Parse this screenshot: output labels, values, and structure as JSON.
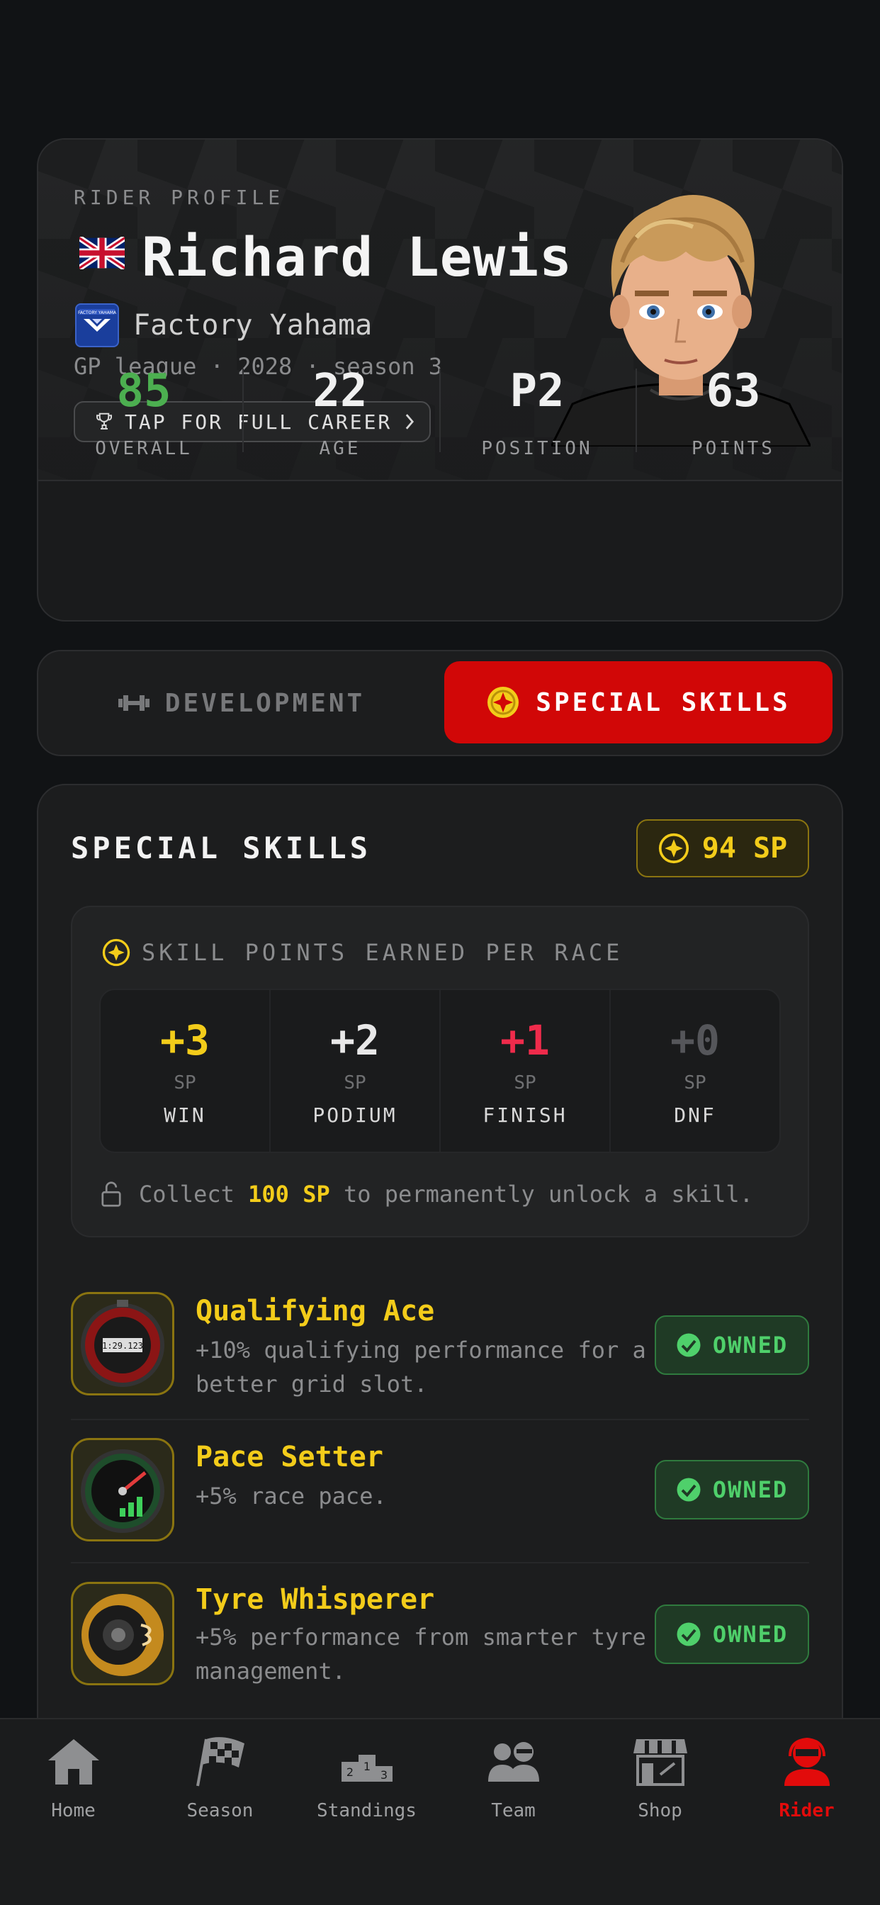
{
  "profile": {
    "section_label": "RIDER PROFILE",
    "name": "Richard Lewis",
    "flag": "uk-flag",
    "team_logo_text": "FACTORY YAHAMA",
    "team": "Factory Yahama",
    "league_line": "GP league · 2028 · season 3",
    "career_button": "TAP FOR FULL CAREER",
    "stats": [
      {
        "value": "85",
        "label": "OVERALL",
        "color": "#4caf50"
      },
      {
        "value": "22",
        "label": "AGE",
        "color": "#f0f0f0"
      },
      {
        "value": "P2",
        "label": "POSITION",
        "color": "#f0f0f0"
      },
      {
        "value": "63",
        "label": "POINTS",
        "color": "#f0f0f0"
      }
    ]
  },
  "tabs": {
    "development": "DEVELOPMENT",
    "special_skills": "SPECIAL SKILLS",
    "active": "special_skills",
    "accent": "#d10707"
  },
  "skills": {
    "title": "SPECIAL SKILLS",
    "sp_balance": "94 SP",
    "earn_title": "SKILL POINTS EARNED PER RACE",
    "earn": [
      {
        "points": "+3",
        "unit": "SP",
        "label": "WIN",
        "color": "#f3cc1a"
      },
      {
        "points": "+2",
        "unit": "SP",
        "label": "PODIUM",
        "color": "#e8e8e8"
      },
      {
        "points": "+1",
        "unit": "SP",
        "label": "FINISH",
        "color": "#ef2b4b"
      },
      {
        "points": "+0",
        "unit": "SP",
        "label": "DNF",
        "color": "#55565a"
      }
    ],
    "collect_prefix": "Collect",
    "collect_amount": "100 SP",
    "collect_suffix": "to permanently unlock a skill.",
    "items": [
      {
        "name": "Qualifying Ace",
        "desc": "+10% qualifying performance for a better grid slot.",
        "status": "OWNED",
        "icon": "stopwatch-icon",
        "icon_text": "1:29.123"
      },
      {
        "name": "Pace Setter",
        "desc": "+5% race pace.",
        "status": "OWNED",
        "icon": "speedometer-icon"
      },
      {
        "name": "Tyre Whisperer",
        "desc": "+5% performance from smarter tyre management.",
        "status": "OWNED",
        "icon": "tyre-icon"
      }
    ]
  },
  "nav": {
    "items": [
      {
        "label": "Home",
        "icon": "home-icon"
      },
      {
        "label": "Season",
        "icon": "checkered-flag-icon"
      },
      {
        "label": "Standings",
        "icon": "podium-icon"
      },
      {
        "label": "Team",
        "icon": "team-icon"
      },
      {
        "label": "Shop",
        "icon": "shop-icon"
      },
      {
        "label": "Rider",
        "icon": "rider-icon"
      }
    ],
    "active": "Rider",
    "active_color": "#e20b0b"
  }
}
